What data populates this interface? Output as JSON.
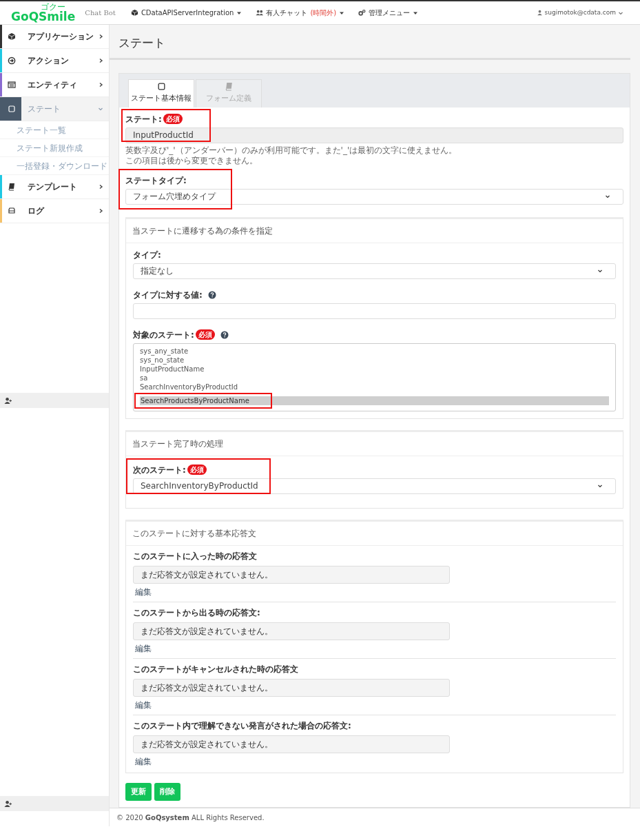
{
  "navbar": {
    "brand": "GoQSmile",
    "brand_ruby": "ゴクー",
    "subtitle": "Chat Bot",
    "menus": [
      {
        "label": "CDataAPIServerIntegration"
      },
      {
        "label": "有人チャット",
        "note": "(時間外)"
      },
      {
        "label": "管理メニュー"
      }
    ],
    "user": "sugimotok@cdata.com"
  },
  "sidebar": {
    "items": [
      {
        "label": "アプリケーション",
        "color": "#333333",
        "selected": false,
        "expanded": false
      },
      {
        "label": "アクション",
        "color": "#1fc8e3",
        "selected": false,
        "expanded": false
      },
      {
        "label": "エンティティ",
        "color": "#8a6bd1",
        "selected": false,
        "expanded": false
      },
      {
        "label": "ステート",
        "color": "#4a5a6b",
        "selected": true,
        "expanded": true,
        "children": [
          {
            "label": "ステート一覧"
          },
          {
            "label": "ステート新規作成"
          },
          {
            "label": "一括登録・ダウンロード"
          }
        ]
      },
      {
        "label": "テンプレート",
        "color": "#1fc8e3",
        "selected": false,
        "expanded": false
      },
      {
        "label": "ログ",
        "color": "#f5c26b",
        "selected": false,
        "expanded": false
      }
    ]
  },
  "page_title": "ステート",
  "tabs": [
    {
      "label": "ステート基本情報",
      "selected": true
    },
    {
      "label": "フォーム定義",
      "selected": false
    }
  ],
  "state_name": {
    "label": "ステート:",
    "required": "必須",
    "value": "InputProductId",
    "highlighted": true,
    "help": [
      "英数字及び'_'（アンダーバー）のみが利用可能です。また'_'は最初の文字に使えません。",
      "この項目は後から変更できません。"
    ]
  },
  "state_type": {
    "label": "ステートタイプ:",
    "value": "フォーム穴埋めタイプ",
    "highlighted": true
  },
  "transition": {
    "title": "当ステートに遷移する為の条件を指定",
    "type": {
      "label": "タイプ:",
      "value": "指定なし"
    },
    "type_value": {
      "label": "タイプに対する値:"
    },
    "target": {
      "label": "対象のステート:",
      "required": "必須",
      "options": [
        {
          "text": "sys_any_state",
          "selected": false,
          "highlighted": false
        },
        {
          "text": "sys_no_state",
          "selected": false,
          "highlighted": false
        },
        {
          "text": "InputProductName",
          "selected": false,
          "highlighted": false
        },
        {
          "text": "sa",
          "selected": false,
          "highlighted": false
        },
        {
          "text": "SearchInventoryByProductId",
          "selected": false,
          "highlighted": false
        },
        {
          "text": "SearchProductsByProductName",
          "selected": true,
          "highlighted": true
        }
      ]
    }
  },
  "completion": {
    "title": "当ステート完了時の処理",
    "next_state": {
      "label": "次のステート:",
      "required": "必須",
      "value": "SearchInventoryByProductId",
      "highlighted": true
    }
  },
  "responses": {
    "title": "このステートに対する基本応答文",
    "items": [
      {
        "label": "このステートに入った時の応答文",
        "value": "まだ応答文が設定されていません。",
        "edit": "編集"
      },
      {
        "label": "このステートから出る時の応答文:",
        "value": "まだ応答文が設定されていません。",
        "edit": "編集"
      },
      {
        "label": "このステートがキャンセルされた時の応答文",
        "value": "まだ応答文が設定されていません。",
        "edit": "編集"
      },
      {
        "label": "このステート内で理解できない発言がされた場合の応答文:",
        "value": "まだ応答文が設定されていません。",
        "edit": "編集"
      }
    ]
  },
  "buttons": [
    {
      "label": "更新"
    },
    {
      "label": "削除"
    }
  ],
  "footer": "© 2020 **GoQsystem** ALL Rights Reserved."
}
